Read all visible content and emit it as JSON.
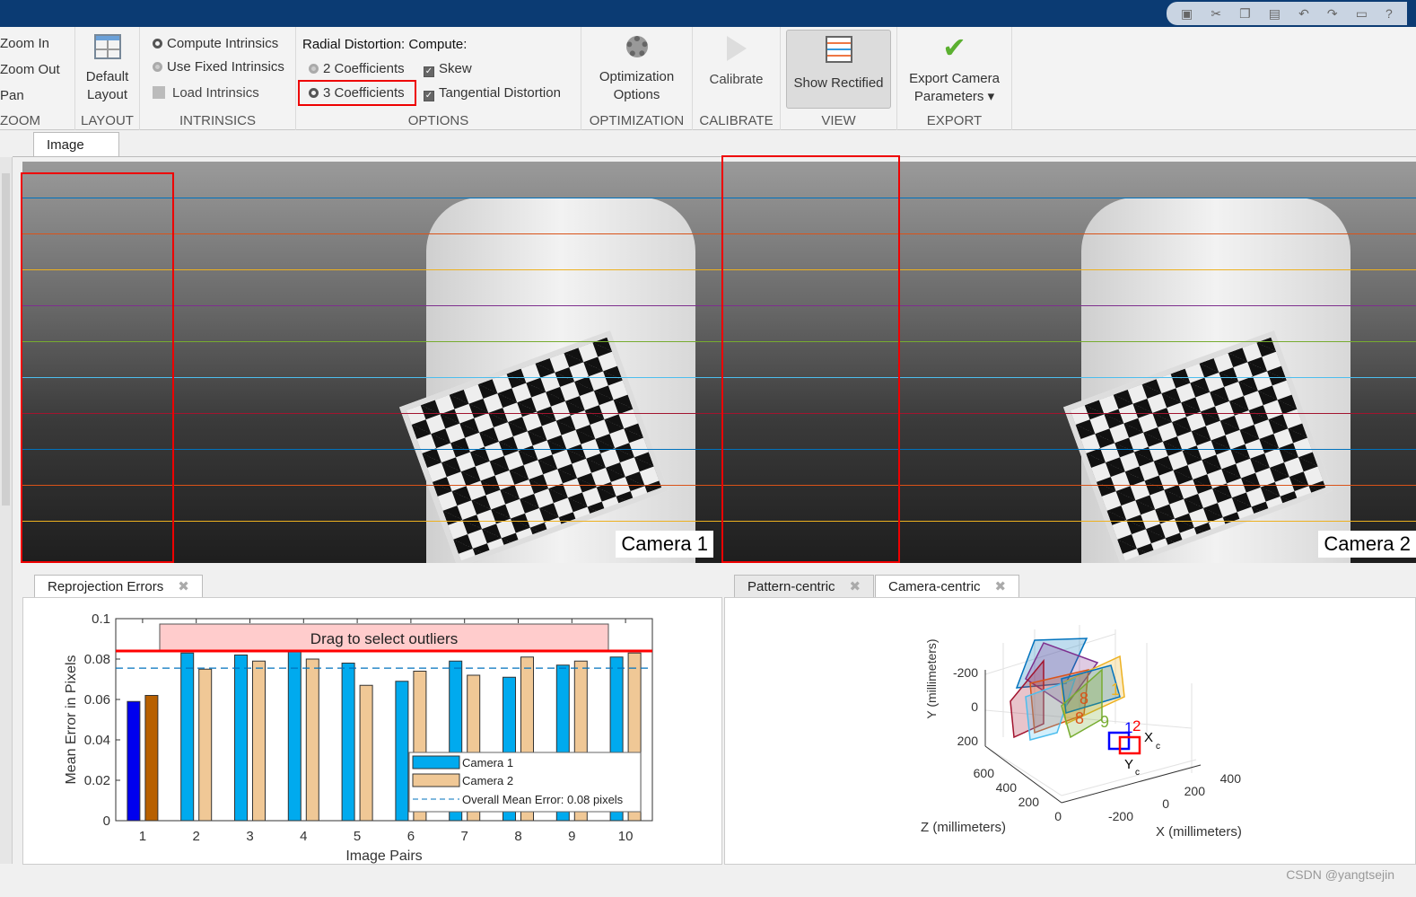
{
  "ribbon": {
    "zoom": {
      "items": [
        "Zoom In",
        "Zoom Out",
        "Pan"
      ],
      "label": "ZOOM"
    },
    "layout": {
      "button": [
        "Default",
        "Layout"
      ],
      "label": "LAYOUT"
    },
    "intrinsics": {
      "items": [
        "Compute Intrinsics",
        "Use Fixed Intrinsics",
        "Load Intrinsics"
      ],
      "selected": "Compute Intrinsics",
      "label": "INTRINSICS"
    },
    "options": {
      "title": "Radial Distortion: Compute:",
      "radios": [
        "2 Coefficients",
        "3 Coefficients"
      ],
      "selected": "3 Coefficients",
      "checks": [
        {
          "label": "Skew",
          "checked": true
        },
        {
          "label": "Tangential Distortion",
          "checked": true
        }
      ],
      "label": "OPTIONS"
    },
    "optimization": {
      "button": [
        "Optimization",
        "Options"
      ],
      "label": "OPTIMIZATION"
    },
    "calibrate": {
      "button": "Calibrate",
      "label": "CALIBRATE"
    },
    "view": {
      "button": "Show Rectified",
      "label": "VIEW",
      "active": true
    },
    "export": {
      "button": [
        "Export Camera",
        "Parameters"
      ],
      "label": "EXPORT"
    }
  },
  "image_tab": {
    "label": "Image"
  },
  "cameras": [
    "Camera 1",
    "Camera 2"
  ],
  "rect_line_colors": [
    "#0072bd",
    "#d95319",
    "#edb120",
    "#7e2f8e",
    "#77ac30",
    "#4dbeee",
    "#a2142f",
    "#0072bd",
    "#d95319",
    "#edb120"
  ],
  "reproj": {
    "tab": "Reprojection Errors"
  },
  "extrinsic": {
    "tabs": [
      "Pattern-centric",
      "Camera-centric"
    ],
    "active": "Camera-centric",
    "ylabel": "Y (millimeters)",
    "zlabel": "Z (millimeters)",
    "xlabel": "X (millimeters)",
    "yticks": [
      "-200",
      "0",
      "200"
    ],
    "zticks": [
      "600",
      "400",
      "200",
      "0"
    ],
    "xticks": [
      "-200",
      "0",
      "200",
      "400"
    ],
    "pattern_labels": [
      "1",
      "6",
      "8",
      "9"
    ],
    "axis_labels": [
      "X",
      "c",
      "Y",
      "c"
    ],
    "camera_labels": [
      "1",
      "2"
    ]
  },
  "chart_data": {
    "type": "bar",
    "title": "",
    "xlabel": "Image Pairs",
    "ylabel": "Mean Error in Pixels",
    "categories": [
      "1",
      "2",
      "3",
      "4",
      "5",
      "6",
      "7",
      "8",
      "9",
      "10"
    ],
    "ylim": [
      0,
      0.1
    ],
    "yticks": [
      "0",
      "0.02",
      "0.04",
      "0.06",
      "0.08",
      "0.1"
    ],
    "series": [
      {
        "name": "Camera 1",
        "color": "#00aaee",
        "selected_color": "#0000ee",
        "values": [
          0.059,
          0.083,
          0.082,
          0.084,
          0.078,
          0.069,
          0.079,
          0.071,
          0.077,
          0.081
        ]
      },
      {
        "name": "Camera 2",
        "color": "#f0c896",
        "selected_color": "#b86000",
        "values": [
          0.062,
          0.075,
          0.079,
          0.08,
          0.067,
          0.074,
          0.072,
          0.081,
          0.079,
          0.083
        ]
      }
    ],
    "selected_index": 0,
    "mean_line": {
      "label": "Overall Mean Error: 0.08 pixels",
      "value": 0.0755,
      "color": "#0072bd"
    },
    "threshold": {
      "value": 0.084,
      "color": "#ff0000",
      "label": "Drag to select outliers"
    },
    "legend": "bottom-right",
    "grid": false
  },
  "watermark": "CSDN @yangtsejin"
}
